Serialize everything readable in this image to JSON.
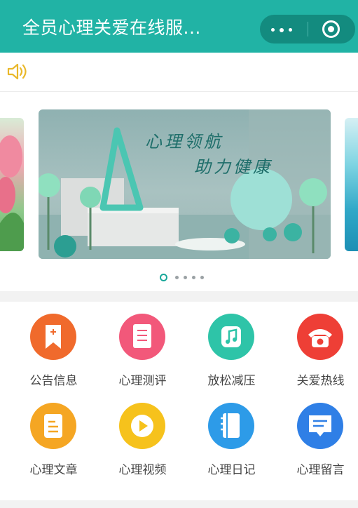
{
  "header": {
    "title": "全员心理关爱在线服...",
    "more_icon": "more-dots-icon",
    "close_icon": "target-circle-icon",
    "bg_color": "#21b3a5"
  },
  "notice": {
    "icon": "speaker-icon",
    "color": "#e9b82a"
  },
  "banner": {
    "line1": "心理领航",
    "line2": "助力健康",
    "slide_count": 5,
    "active_slide": 1
  },
  "grid": {
    "items": [
      {
        "label": "公告信息",
        "icon": "bookmark-icon",
        "color": "#f06a2c"
      },
      {
        "label": "心理测评",
        "icon": "checklist-icon",
        "color": "#f2587a"
      },
      {
        "label": "放松减压",
        "icon": "music-note-icon",
        "color": "#2ec4a8"
      },
      {
        "label": "关爱热线",
        "icon": "telephone-icon",
        "color": "#ee3f36"
      },
      {
        "label": "心理文章",
        "icon": "document-icon",
        "color": "#f5a623"
      },
      {
        "label": "心理视频",
        "icon": "play-icon",
        "color": "#f6c21c"
      },
      {
        "label": "心理日记",
        "icon": "notebook-icon",
        "color": "#2d9be8"
      },
      {
        "label": "心理留言",
        "icon": "message-icon",
        "color": "#2f7fe6"
      }
    ]
  }
}
